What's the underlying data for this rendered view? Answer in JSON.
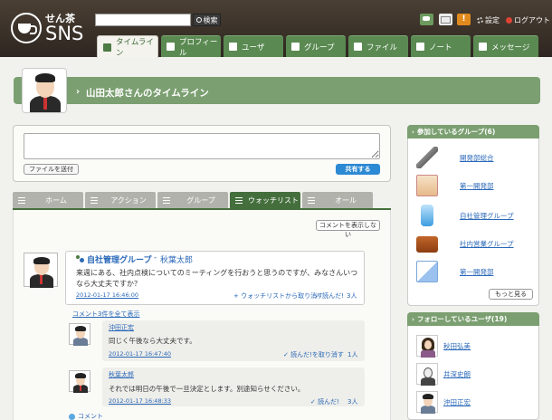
{
  "header": {
    "logo_top": "せん茶",
    "logo_bottom": "SNS",
    "search_placeholder": "",
    "search_button": "検索",
    "alert_label": "!",
    "settings": "設定",
    "logout": "ログアウト"
  },
  "nav": {
    "tabs": [
      {
        "label": "タイムライン",
        "active": true
      },
      {
        "label": "プロフィール"
      },
      {
        "label": "ユーザ"
      },
      {
        "label": "グループ"
      },
      {
        "label": "ファイル"
      },
      {
        "label": "ノート"
      },
      {
        "label": "メッセージ"
      }
    ]
  },
  "profile": {
    "timeline_title": "山田太郎さんのタイムライン",
    "chevron": "›"
  },
  "composer": {
    "attach_button": "ファイルを送付",
    "share_button": "共有する"
  },
  "subtabs": [
    {
      "label": "ホーム"
    },
    {
      "label": "アクション"
    },
    {
      "label": "グループ"
    },
    {
      "label": "ウォッチリスト",
      "active": true
    },
    {
      "label": "オール"
    }
  ],
  "feed": {
    "hide_comments_button": "コメントを表示しない",
    "post": {
      "group": "自社管理グループ",
      "separator": "-",
      "author": "秋葉太郎",
      "text": "来週にある、社内点検についてのミーティングを行おうと思うのですが、みなさんいつなら大丈夫ですか？",
      "time": "2012-01-17 16:46:00",
      "unwatch": "ウォッチリストから取り消す",
      "read": "読んだ!",
      "read_count": "3人"
    },
    "show_all_comments": "コメント3件を全て表示",
    "comments": [
      {
        "name": "沖田正宏",
        "text": "同じく午後なら大丈夫です。",
        "time": "2012-01-17 16:47:40",
        "read": "読んだ!を取り消す",
        "read_count": "1人"
      },
      {
        "name": "秋葉太郎",
        "text": "それでは明日の午後で一旦決定とします。別途知らせください。",
        "time": "2012-01-17 16:48:33",
        "read": "読んだ!",
        "read_count": "3人"
      }
    ],
    "comment_footer": "コメント"
  },
  "groups_panel": {
    "title": "参加しているグループ(6)",
    "items": [
      {
        "label": "開発部総合",
        "icon": "hammer-icon"
      },
      {
        "label": "第一開発部",
        "icon": "chart-icon"
      },
      {
        "label": "自社管理グループ",
        "icon": "water-bottle-icon"
      },
      {
        "label": "社内営業グループ",
        "icon": "briefcase-icon"
      },
      {
        "label": "第一開発部",
        "icon": "document-icon"
      }
    ],
    "more_button": "もっと見る"
  },
  "users_panel": {
    "title": "フォローしているユーザ(19)",
    "items": [
      {
        "label": "秋田弘美"
      },
      {
        "label": "井深史朗"
      },
      {
        "label": "沖田正宏"
      }
    ]
  },
  "colors": {
    "accent_green": "#5a8a52",
    "link_blue": "#2a68b8",
    "header_brown": "#3a3028",
    "share_blue": "#2c89d4"
  }
}
